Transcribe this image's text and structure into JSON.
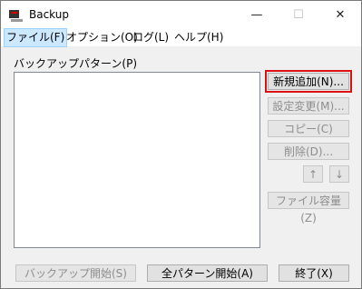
{
  "window": {
    "title": "Backup",
    "minimize": "—",
    "maximize": "☐",
    "close": "✕"
  },
  "menu": [
    "ファイル(F)",
    "オプション(O)",
    "ログ(L)",
    "ヘルプ(H)"
  ],
  "pattern_label": "バックアップパターン(P)",
  "buttons": {
    "new": "新規追加(N)...",
    "edit": "設定変更(M)...",
    "copy": "コピー(C)",
    "delete": "削除(D)...",
    "up": "↑",
    "down": "↓",
    "size": "ファイル容量(Z)",
    "start": "バックアップ開始(S)",
    "start_all": "全パターン開始(A)",
    "exit": "終了(X)"
  }
}
